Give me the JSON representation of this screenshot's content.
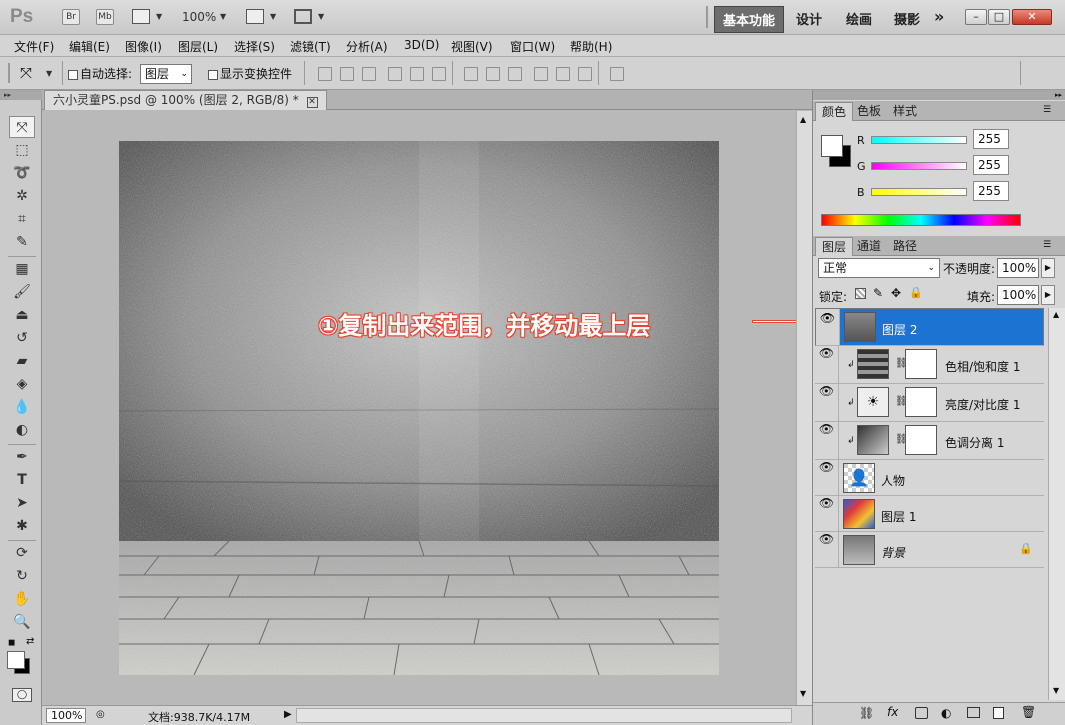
{
  "app": {
    "logo": "Ps",
    "bridge": "Br",
    "minibridge": "Mb",
    "zoom": "100%"
  },
  "workspaces": [
    "基本功能",
    "设计",
    "绘画",
    "摄影"
  ],
  "workspace_more": "»",
  "menu": [
    "文件(F)",
    "编辑(E)",
    "图像(I)",
    "图层(L)",
    "选择(S)",
    "滤镜(T)",
    "分析(A)",
    "3D(D)",
    "视图(V)",
    "窗口(W)",
    "帮助(H)"
  ],
  "options": {
    "auto_select_label": "自动选择:",
    "auto_select_value": "图层",
    "show_transform_label": "显示变换控件"
  },
  "document": {
    "tab_title": "六小灵童PS.psd @ 100% (图层 2, RGB/8) *",
    "zoom": "100%",
    "doc_info": "文档:938.7K/4.17M"
  },
  "annotation": "①复制出来范围，并移动最上层",
  "color_panel": {
    "tabs": [
      "颜色",
      "色板",
      "样式"
    ],
    "channels": [
      {
        "label": "R",
        "value": "255"
      },
      {
        "label": "G",
        "value": "255"
      },
      {
        "label": "B",
        "value": "255"
      }
    ]
  },
  "layers_panel": {
    "tabs": [
      "图层",
      "通道",
      "路径"
    ],
    "blend_mode": "正常",
    "opacity_label": "不透明度:",
    "opacity_value": "100%",
    "lock_label": "锁定:",
    "fill_label": "填充:",
    "fill_value": "100%",
    "layers": [
      {
        "name": "图层 2",
        "selected": true
      },
      {
        "name": "色相/饱和度 1"
      },
      {
        "name": "亮度/对比度 1"
      },
      {
        "name": "色调分离 1"
      },
      {
        "name": "人物"
      },
      {
        "name": "图层 1"
      },
      {
        "name": "背景"
      }
    ]
  },
  "colors": {
    "accent": "#1d73d2",
    "annotation_red": "#e8432f"
  }
}
